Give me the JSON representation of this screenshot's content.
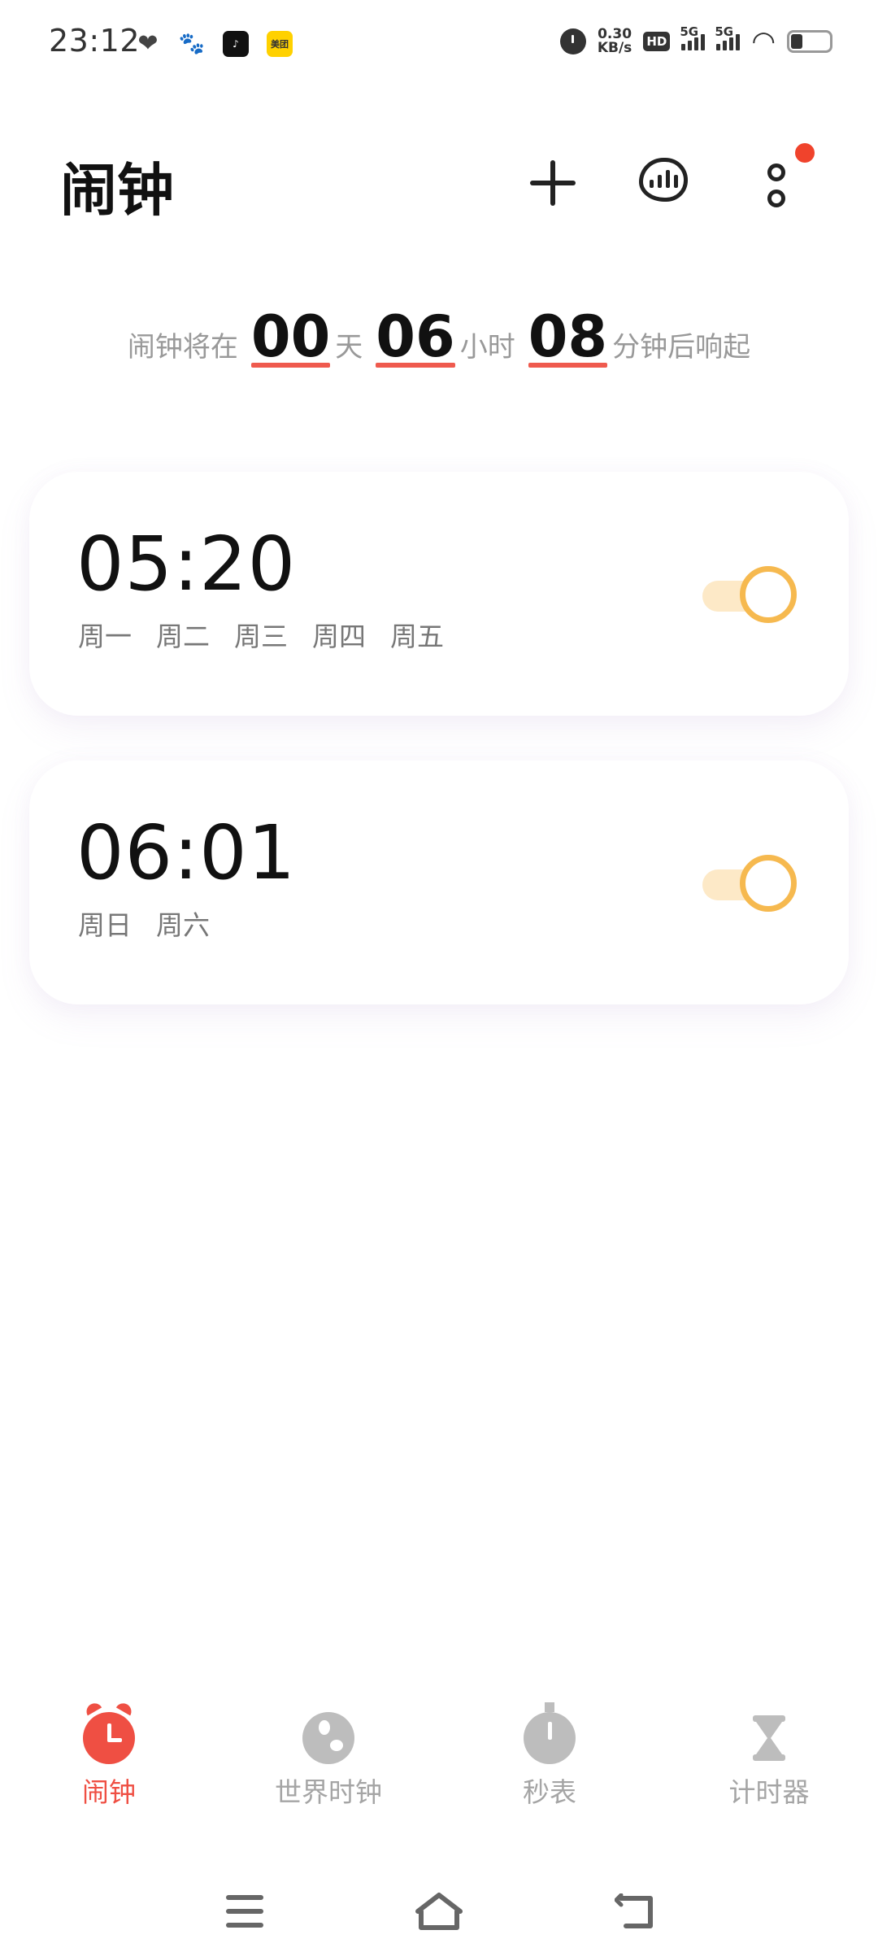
{
  "status_bar": {
    "time": "23:12",
    "notif_douyin": "♪",
    "notif_meituan": "美团",
    "net_speed_value": "0.30",
    "net_speed_unit": "KB/s",
    "hd_label": "HD",
    "signal_1": "5G",
    "signal_2": "5G"
  },
  "header": {
    "title": "闹钟",
    "add_icon": "plus-icon",
    "stats_icon": "stats-icon",
    "more_icon": "more-icon",
    "badge_color": "#f0432c"
  },
  "countdown": {
    "prefix": "闹钟将在",
    "days": "00",
    "days_unit": "天",
    "hours": "06",
    "hours_unit": "小时",
    "minutes": "08",
    "minutes_suffix": "分钟后响起"
  },
  "alarms": [
    {
      "time": "05:20",
      "days": [
        "周一",
        "周二",
        "周三",
        "周四",
        "周五"
      ],
      "enabled": true
    },
    {
      "time": "06:01",
      "days": [
        "周日",
        "周六"
      ],
      "enabled": true
    }
  ],
  "tabs": [
    {
      "label": "闹钟",
      "icon": "alarm-clock-icon",
      "active": true
    },
    {
      "label": "世界时钟",
      "icon": "globe-icon",
      "active": false
    },
    {
      "label": "秒表",
      "icon": "stopwatch-icon",
      "active": false
    },
    {
      "label": "计时器",
      "icon": "hourglass-icon",
      "active": false
    }
  ],
  "colors": {
    "accent": "#ef4f43",
    "toggle_on": "#f6b94f",
    "toggle_track": "#fde9c7"
  }
}
